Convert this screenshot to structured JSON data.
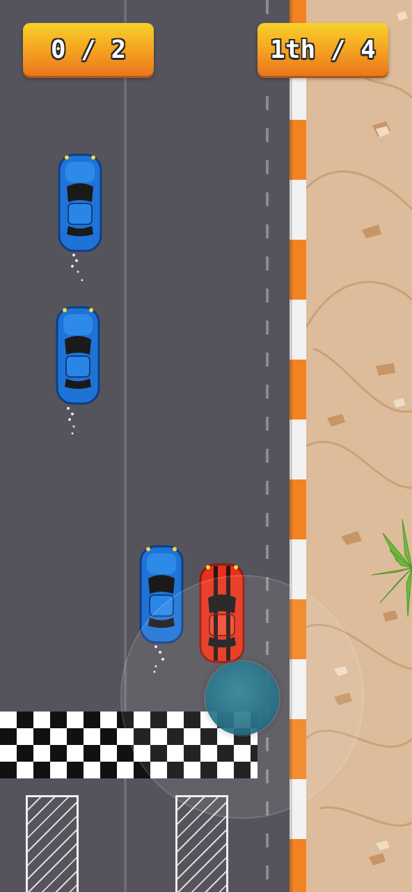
{
  "hud": {
    "lap_counter": "0 / 2",
    "position": "1th / 4"
  },
  "colors": {
    "road": "#55545c",
    "curb_orange": "#f28322",
    "curb_white": "#f2f2f2",
    "sand": "#dcbc9b",
    "player_car": "#e6321c",
    "opponent_car": "#1f73d6",
    "hud_badge": "#f4a020",
    "joystick": "#256f86"
  },
  "cars": [
    {
      "role": "opponent",
      "color_name": "blue"
    },
    {
      "role": "opponent",
      "color_name": "blue"
    },
    {
      "role": "opponent",
      "color_name": "blue"
    },
    {
      "role": "player",
      "color_name": "red"
    }
  ],
  "icons": [
    "palm-plant-icon",
    "finish-line-icon",
    "joystick-knob-icon"
  ]
}
